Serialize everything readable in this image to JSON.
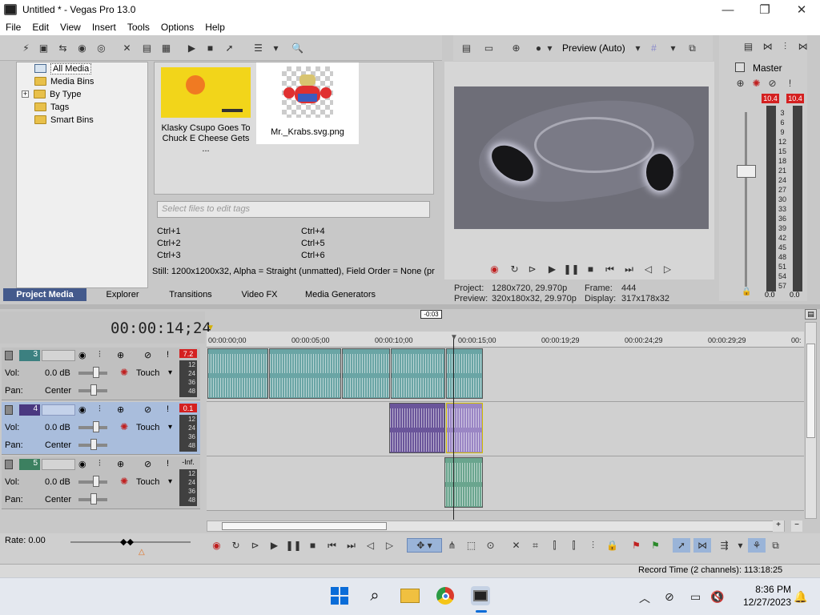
{
  "window": {
    "title": "Untitled * - Vegas Pro 13.0",
    "minimize": "—",
    "maximize": "❐",
    "close": "✕"
  },
  "menu": [
    "File",
    "Edit",
    "View",
    "Insert",
    "Tools",
    "Options",
    "Help"
  ],
  "explorer": {
    "tree": [
      "All Media",
      "Media Bins",
      "By Type",
      "Tags",
      "Smart Bins"
    ],
    "expander": "+",
    "media": [
      {
        "label": "Klasky Csupo Goes To Chuck E Cheese Gets ..."
      },
      {
        "label": "Mr._Krabs.svg.png"
      }
    ],
    "tag_placeholder": "Select files to edit tags",
    "shortcuts": [
      "Ctrl+1",
      "Ctrl+4",
      "Ctrl+2",
      "Ctrl+5",
      "Ctrl+3",
      "Ctrl+6"
    ],
    "info": "Still: 1200x1200x32, Alpha = Straight (unmatted), Field Order = None (pr",
    "tabs": [
      "Project Media",
      "Explorer",
      "Transitions",
      "Video FX",
      "Media Generators"
    ]
  },
  "preview": {
    "mode": "Preview (Auto)",
    "project_label": "Project:",
    "project_value": "1280x720, 29.970p",
    "frame_label": "Frame:",
    "frame_value": "444",
    "preview_label": "Preview:",
    "preview_value": "320x180x32, 29.970p",
    "display_label": "Display:",
    "display_value": "317x178x32"
  },
  "master": {
    "label": "Master",
    "peak_left": "10.4",
    "peak_right": "10.4",
    "scale": [
      "3",
      "6",
      "9",
      "12",
      "15",
      "18",
      "21",
      "24",
      "27",
      "30",
      "33",
      "36",
      "39",
      "42",
      "45",
      "48",
      "51",
      "54",
      "57"
    ],
    "bottom_left": "0.0",
    "bottom_right": "0.0"
  },
  "timeline": {
    "time": "00:00:14;24",
    "marker": "-0:03",
    "ruler": [
      "00:00:00;00",
      "00:00:05;00",
      "00:00:10;00",
      "00:00:15;00",
      "00:00:19;29",
      "00:00:24;29",
      "00:00:29;29",
      "00:"
    ],
    "tracks": [
      {
        "num": "3",
        "vol_label": "Vol:",
        "vol": "0.0 dB",
        "pan_label": "Pan:",
        "pan": "Center",
        "mode": "Touch",
        "peak": "7.2",
        "scale": [
          "12",
          "24",
          "36",
          "48"
        ]
      },
      {
        "num": "4",
        "vol_label": "Vol:",
        "vol": "0.0 dB",
        "pan_label": "Pan:",
        "pan": "Center",
        "mode": "Touch",
        "peak": "0.1",
        "scale": [
          "12",
          "24",
          "36",
          "48"
        ]
      },
      {
        "num": "5",
        "vol_label": "Vol:",
        "vol": "0.0 dB",
        "pan_label": "Pan:",
        "pan": "Center",
        "mode": "Touch",
        "peak": "-Inf.",
        "scale": [
          "12",
          "24",
          "36",
          "48"
        ]
      }
    ],
    "rate": "Rate: 0.00"
  },
  "status": {
    "record_time": "Record Time (2 channels): 113:18:25"
  },
  "taskbar": {
    "time": "8:36 PM",
    "date": "12/27/2023"
  },
  "colors": {
    "accent": "#445a8c",
    "teal_clip": "#6aa5a5",
    "purple_clip": "#6a559a",
    "peak_red": "#d42020"
  }
}
